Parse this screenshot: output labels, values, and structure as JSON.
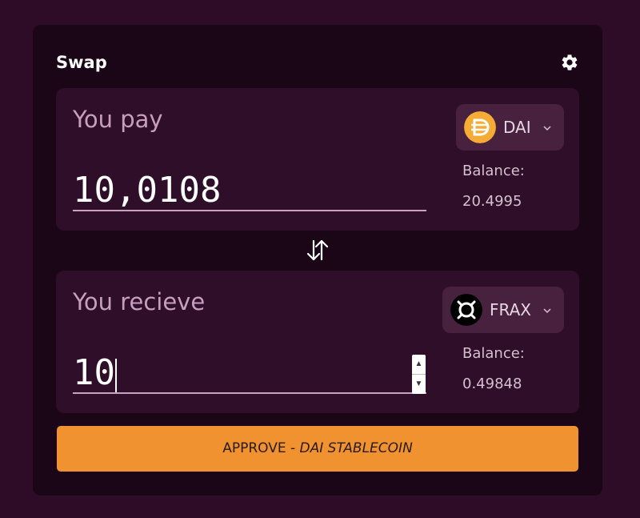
{
  "swap": {
    "title": "Swap",
    "settings_icon": "gear-icon",
    "swap_direction_icon": "swap-arrows-icon"
  },
  "pay": {
    "label": "You pay",
    "amount": "10,0108",
    "token": {
      "symbol": "DAI",
      "icon": "dai-icon",
      "icon_color": "#f5ac37"
    },
    "balance_label": "Balance:",
    "balance_value": "20.4995"
  },
  "receive": {
    "label": "You recieve",
    "amount": "10",
    "token": {
      "symbol": "FRAX",
      "icon": "frax-icon",
      "icon_color": "#000000"
    },
    "balance_label": "Balance:",
    "balance_value": "0.49848"
  },
  "approve_button": {
    "prefix": "APPROVE - ",
    "token_name": "DAI STABLECOIN",
    "color": "#f0922f"
  },
  "colors": {
    "background": "#2e0b26",
    "card": "#1a0616",
    "panel": "#2f0e29",
    "token_button": "#47213e",
    "label": "#c79fbe"
  }
}
